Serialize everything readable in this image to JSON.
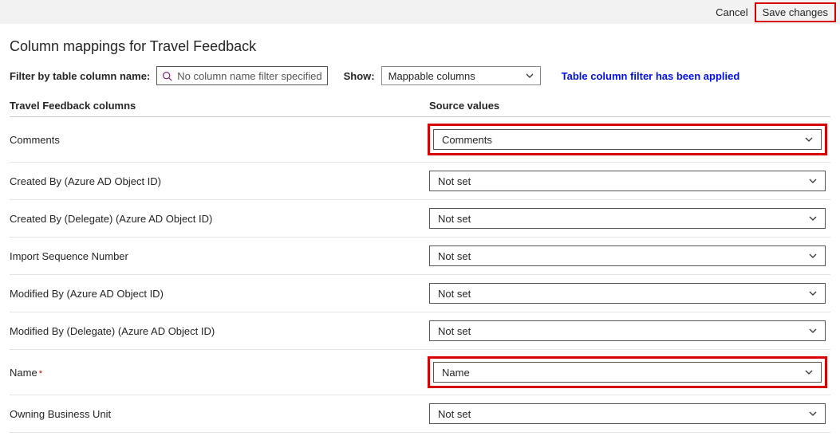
{
  "topbar": {
    "cancel_label": "Cancel",
    "save_label": "Save changes"
  },
  "page_title": "Column mappings for Travel Feedback",
  "filter": {
    "label": "Filter by table column name:",
    "placeholder": "No column name filter specified",
    "show_label": "Show:",
    "show_value": "Mappable columns",
    "status": "Table column filter has been applied"
  },
  "headers": {
    "left": "Travel Feedback columns",
    "right": "Source values"
  },
  "rows": [
    {
      "label": "Comments",
      "value": "Comments",
      "required": false,
      "highlight": true
    },
    {
      "label": "Created By (Azure AD Object ID)",
      "value": "Not set",
      "required": false,
      "highlight": false
    },
    {
      "label": "Created By (Delegate) (Azure AD Object ID)",
      "value": "Not set",
      "required": false,
      "highlight": false
    },
    {
      "label": "Import Sequence Number",
      "value": "Not set",
      "required": false,
      "highlight": false
    },
    {
      "label": "Modified By (Azure AD Object ID)",
      "value": "Not set",
      "required": false,
      "highlight": false
    },
    {
      "label": "Modified By (Delegate) (Azure AD Object ID)",
      "value": "Not set",
      "required": false,
      "highlight": false
    },
    {
      "label": "Name",
      "value": "Name",
      "required": true,
      "highlight": true
    },
    {
      "label": "Owning Business Unit",
      "value": "Not set",
      "required": false,
      "highlight": false
    }
  ]
}
